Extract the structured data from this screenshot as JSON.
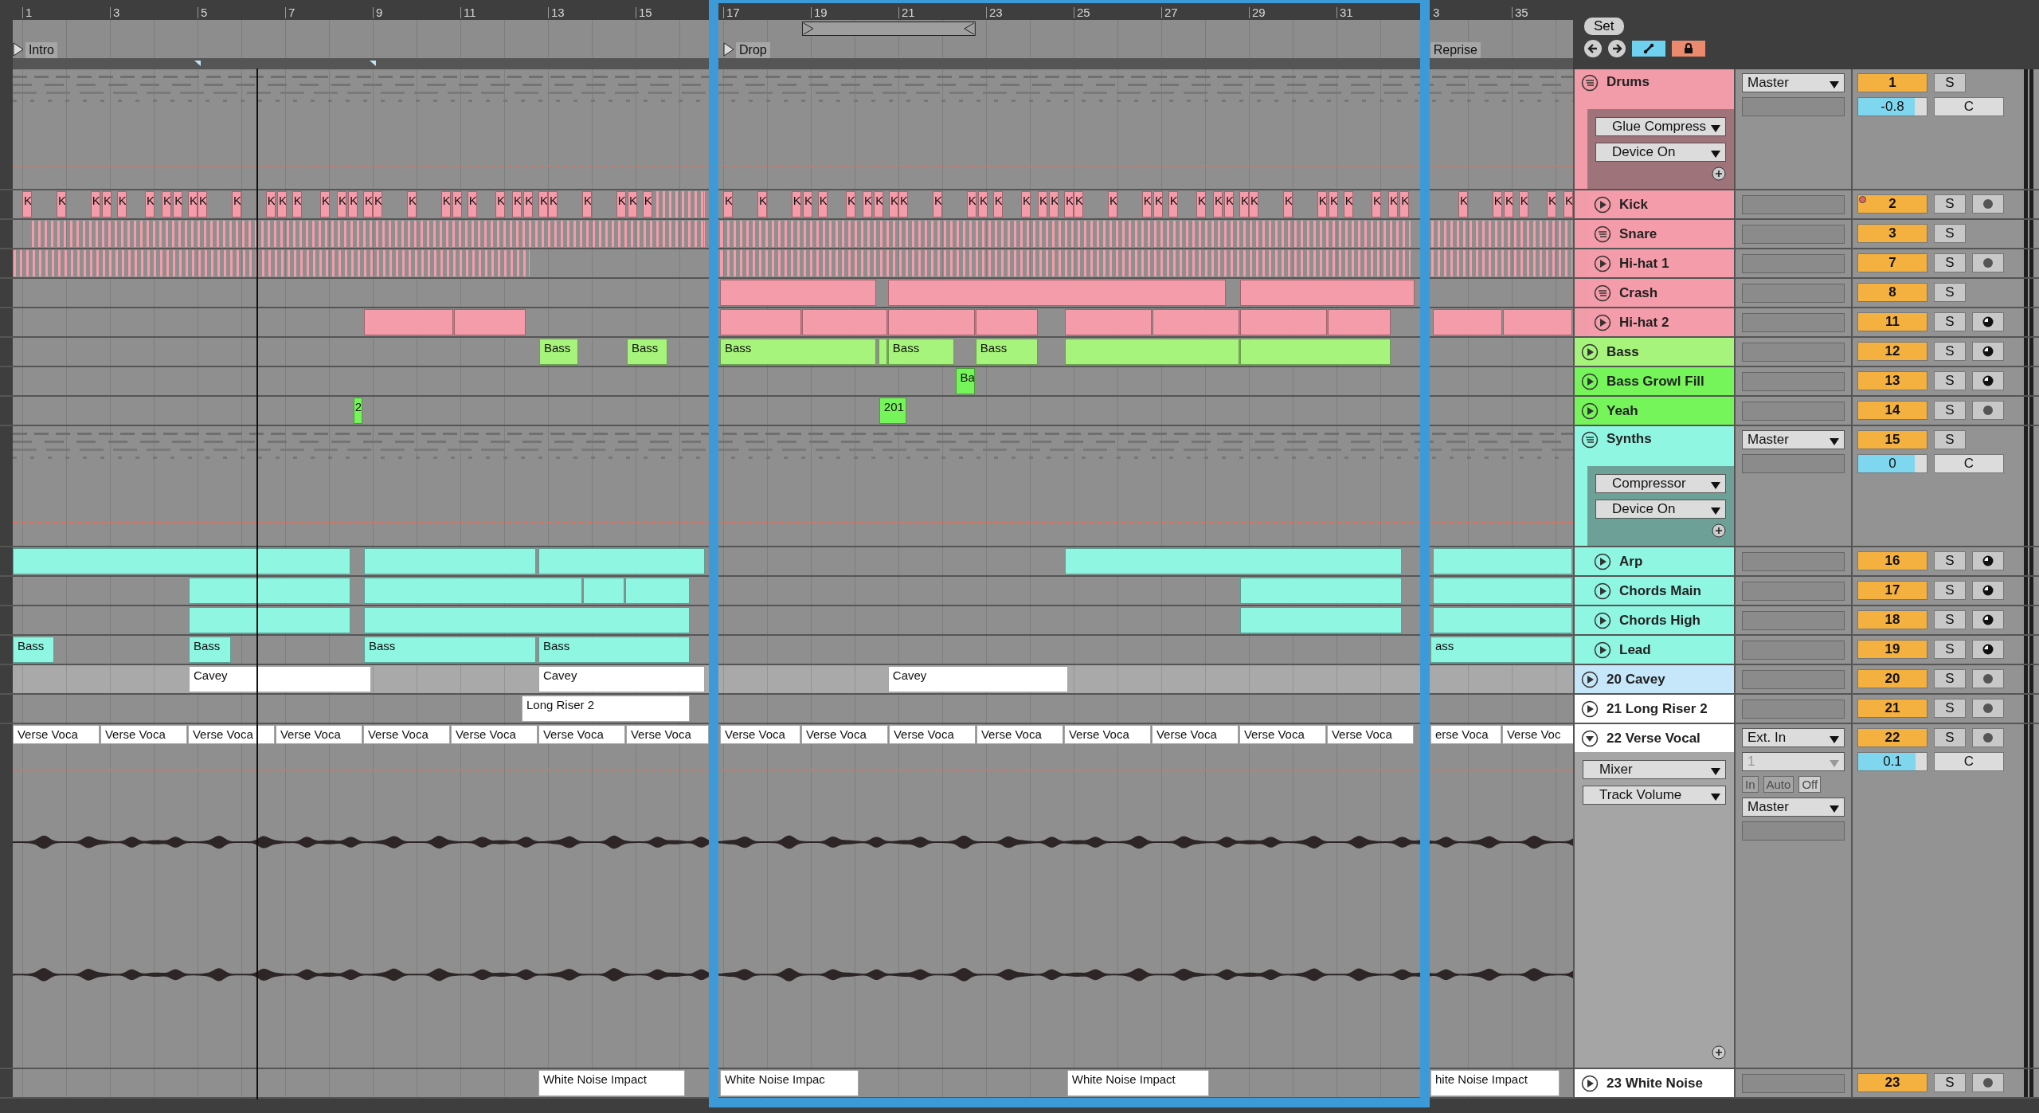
{
  "ruler": [
    "1",
    "3",
    "5",
    "7",
    "9",
    "11",
    "13",
    "15",
    "17",
    "19",
    "21",
    "23",
    "25",
    "27",
    "29",
    "31",
    "3",
    "35"
  ],
  "locators": [
    {
      "label": "Intro"
    },
    {
      "label": "Drop"
    },
    {
      "label": "Reprise"
    }
  ],
  "set_panel": {
    "label": "Set",
    "toggles": [
      {
        "on": true
      },
      {
        "on": true
      }
    ]
  },
  "tracks": [
    {
      "name": "Drums",
      "kind": "group",
      "expanded": true,
      "selected": false,
      "alert": false,
      "automation": true,
      "color": "#f29ca9",
      "devices": {
        "device": "Glue Compress",
        "parameter": "Device On"
      },
      "io": {
        "output": "Master"
      },
      "number": "1",
      "solo": "S",
      "volume": {
        "value": "-0.8",
        "level": 0.82
      },
      "pan": "C",
      "children": [
        {
          "name": "Kick",
          "kind": "track",
          "expanded": false,
          "selected": false,
          "alert": true,
          "automation": false,
          "color": "#f49ca9",
          "number": "2",
          "solo": "S",
          "arm": {
            "kind": "dot"
          },
          "clips": [
            {
              "kind": "block",
              "label": "K"
            },
            {
              "kind": "block",
              "label": "K"
            },
            {
              "kind": "block",
              "label": "K"
            },
            {
              "kind": "block",
              "label": "K"
            },
            {
              "kind": "block",
              "label": "K"
            },
            {
              "kind": "block",
              "label": "K"
            },
            {
              "kind": "block",
              "label": "K"
            },
            {
              "kind": "block",
              "label": "K"
            },
            {
              "kind": "block",
              "label": "K"
            },
            {
              "kind": "block",
              "label": "K"
            },
            {
              "kind": "block",
              "label": "K"
            },
            {
              "kind": "block",
              "label": "K"
            },
            {
              "kind": "block",
              "label": "K"
            },
            {
              "kind": "block",
              "label": "K"
            },
            {
              "kind": "block",
              "label": "K"
            },
            {
              "kind": "block",
              "label": "K"
            },
            {
              "kind": "block",
              "label": "K"
            },
            {
              "kind": "block",
              "label": "K"
            },
            {
              "kind": "block",
              "label": "K"
            },
            {
              "kind": "block",
              "label": "K"
            },
            {
              "kind": "block",
              "label": "K"
            },
            {
              "kind": "block",
              "label": "K"
            },
            {
              "kind": "block",
              "label": "K"
            },
            {
              "kind": "block",
              "label": "K"
            },
            {
              "kind": "block",
              "label": "K"
            },
            {
              "kind": "block",
              "label": "K"
            },
            {
              "kind": "block",
              "label": "K"
            },
            {
              "kind": "block",
              "label": "K"
            },
            {
              "kind": "block",
              "label": "K"
            },
            {
              "kind": "block",
              "label": "K"
            },
            {
              "kind": "block",
              "label": "K"
            },
            {
              "kind": "block",
              "label": "K"
            },
            {
              "kind": "pattern"
            },
            {
              "kind": "block",
              "label": "K"
            },
            {
              "kind": "block",
              "label": "K"
            },
            {
              "kind": "block",
              "label": "K"
            },
            {
              "kind": "block",
              "label": "K"
            },
            {
              "kind": "block",
              "label": "K"
            },
            {
              "kind": "block",
              "label": "K"
            },
            {
              "kind": "block",
              "label": "K"
            },
            {
              "kind": "block",
              "label": "K"
            },
            {
              "kind": "block",
              "label": "K"
            },
            {
              "kind": "block",
              "label": "K"
            },
            {
              "kind": "block",
              "label": "K"
            },
            {
              "kind": "block",
              "label": "K"
            },
            {
              "kind": "block",
              "label": "K"
            },
            {
              "kind": "block",
              "label": "K"
            },
            {
              "kind": "block",
              "label": "K"
            },
            {
              "kind": "block",
              "label": "K"
            },
            {
              "kind": "block",
              "label": "K"
            },
            {
              "kind": "block",
              "label": "K"
            },
            {
              "kind": "block",
              "label": "K"
            },
            {
              "kind": "block",
              "label": "K"
            },
            {
              "kind": "block",
              "label": "K"
            },
            {
              "kind": "block",
              "label": "K"
            },
            {
              "kind": "block",
              "label": "K"
            },
            {
              "kind": "block",
              "label": "K"
            },
            {
              "kind": "block",
              "label": "K"
            },
            {
              "kind": "block",
              "label": "K"
            },
            {
              "kind": "block",
              "label": "K"
            },
            {
              "kind": "block",
              "label": "K"
            },
            {
              "kind": "block",
              "label": "K"
            },
            {
              "kind": "block",
              "label": "K"
            },
            {
              "kind": "block",
              "label": "K"
            },
            {
              "kind": "block",
              "label": "K"
            },
            {
              "kind": "block",
              "label": "K"
            },
            {
              "kind": "block",
              "label": "K"
            },
            {
              "kind": "block",
              "label": "K"
            },
            {
              "kind": "block",
              "label": "K"
            },
            {
              "kind": "block",
              "label": "K"
            },
            {
              "kind": "block",
              "label": "K"
            },
            {
              "kind": "block",
              "label": "K"
            },
            {
              "kind": "block",
              "label": "K"
            },
            {
              "kind": "block",
              "label": "K"
            }
          ]
        },
        {
          "name": "Snare",
          "kind": "rack",
          "expanded": false,
          "selected": false,
          "alert": false,
          "automation": false,
          "color": "#f49ca9",
          "number": "3",
          "solo": "S",
          "clips": [
            {
              "kind": "pattern"
            },
            {
              "kind": "pattern"
            },
            {
              "kind": "pattern"
            }
          ]
        },
        {
          "name": "Hi-hat 1",
          "kind": "track",
          "expanded": false,
          "selected": false,
          "alert": false,
          "automation": false,
          "color": "#f49ca9",
          "number": "7",
          "solo": "S",
          "arm": {
            "kind": "dot"
          },
          "clips": [
            {
              "kind": "pattern"
            },
            {
              "kind": "pattern"
            },
            {
              "kind": "pattern"
            }
          ]
        },
        {
          "name": "Crash",
          "kind": "rack",
          "expanded": false,
          "selected": false,
          "alert": false,
          "automation": false,
          "color": "#f49ca9",
          "number": "8",
          "solo": "S",
          "clips": [
            {
              "kind": "block"
            },
            {
              "kind": "block"
            },
            {
              "kind": "block"
            }
          ]
        },
        {
          "name": "Hi-hat 2",
          "kind": "track",
          "expanded": false,
          "selected": false,
          "alert": false,
          "automation": false,
          "color": "#f49ca9",
          "number": "11",
          "solo": "S",
          "arm": {
            "kind": "half"
          },
          "clips": [
            {
              "kind": "block"
            },
            {
              "kind": "block"
            },
            {
              "kind": "block"
            },
            {
              "kind": "block"
            },
            {
              "kind": "block"
            },
            {
              "kind": "block"
            },
            {
              "kind": "block"
            },
            {
              "kind": "block"
            },
            {
              "kind": "block"
            },
            {
              "kind": "block"
            },
            {
              "kind": "block"
            },
            {
              "kind": "block"
            }
          ]
        }
      ]
    },
    {
      "name": "Bass",
      "kind": "track",
      "expanded": false,
      "selected": false,
      "alert": false,
      "automation": false,
      "color": "#a7f47c",
      "number": "12",
      "solo": "S",
      "arm": {
        "kind": "half"
      },
      "clips": [
        {
          "kind": "block",
          "label": "Bass"
        },
        {
          "kind": "block",
          "label": "Bass"
        },
        {
          "kind": "block",
          "label": "Bass"
        },
        {
          "kind": "block"
        },
        {
          "kind": "block",
          "label": "Bass"
        },
        {
          "kind": "block",
          "label": "Bass"
        },
        {
          "kind": "block"
        },
        {
          "kind": "block"
        }
      ]
    },
    {
      "name": "Bass Growl Fill",
      "kind": "track",
      "expanded": false,
      "selected": false,
      "alert": false,
      "automation": false,
      "color": "#76f55b",
      "number": "13",
      "solo": "S",
      "arm": {
        "kind": "half"
      },
      "clips": [
        {
          "kind": "block",
          "label": "Ba"
        }
      ]
    },
    {
      "name": "Yeah",
      "kind": "track",
      "expanded": false,
      "selected": false,
      "alert": false,
      "automation": false,
      "color": "#76f55b",
      "number": "14",
      "solo": "S",
      "arm": {
        "kind": "dot"
      },
      "clips": [
        {
          "kind": "block",
          "label": "2"
        },
        {
          "kind": "block",
          "label": "201"
        }
      ]
    },
    {
      "name": "Synths",
      "kind": "group",
      "expanded": true,
      "selected": false,
      "alert": false,
      "automation": true,
      "color": "#8ff6e2",
      "devices": {
        "device": "Compressor",
        "parameter": "Device On"
      },
      "io": {
        "output": "Master"
      },
      "number": "15",
      "solo": "S",
      "volume": {
        "value": "0",
        "level": 0.82
      },
      "pan": "C",
      "children": [
        {
          "name": "Arp",
          "kind": "track",
          "expanded": false,
          "selected": false,
          "alert": false,
          "automation": false,
          "color": "#8ff6e2",
          "number": "16",
          "solo": "S",
          "arm": {
            "kind": "half"
          },
          "clips": [
            {
              "kind": "block"
            },
            {
              "kind": "block"
            },
            {
              "kind": "block"
            },
            {
              "kind": "block"
            },
            {
              "kind": "block"
            }
          ]
        },
        {
          "name": "Chords Main",
          "kind": "track",
          "expanded": false,
          "selected": false,
          "alert": false,
          "automation": false,
          "color": "#8ff6e2",
          "number": "17",
          "solo": "S",
          "arm": {
            "kind": "half"
          },
          "clips": [
            {
              "kind": "block"
            },
            {
              "kind": "block"
            },
            {
              "kind": "block"
            },
            {
              "kind": "block"
            },
            {
              "kind": "block"
            },
            {
              "kind": "block"
            }
          ]
        },
        {
          "name": "Chords High",
          "kind": "track",
          "expanded": false,
          "selected": false,
          "alert": false,
          "automation": false,
          "color": "#8ff6e2",
          "number": "18",
          "solo": "S",
          "arm": {
            "kind": "half"
          },
          "clips": [
            {
              "kind": "block"
            },
            {
              "kind": "block"
            },
            {
              "kind": "block"
            },
            {
              "kind": "block"
            }
          ]
        },
        {
          "name": "Lead",
          "kind": "track",
          "expanded": false,
          "selected": false,
          "alert": false,
          "automation": false,
          "color": "#8ff6e2",
          "number": "19",
          "solo": "S",
          "arm": {
            "kind": "half"
          },
          "clips": [
            {
              "kind": "block",
              "label": "Bass"
            },
            {
              "kind": "block",
              "label": "Bass"
            },
            {
              "kind": "block",
              "label": "Bass"
            },
            {
              "kind": "block",
              "label": "Bass"
            },
            {
              "kind": "block",
              "label": "ass"
            }
          ]
        }
      ]
    },
    {
      "name": "20 Cavey",
      "kind": "track",
      "expanded": false,
      "selected": true,
      "alert": false,
      "automation": false,
      "color": "#ffffff",
      "number": "20",
      "solo": "S",
      "arm": {
        "kind": "dot"
      },
      "clips": [
        {
          "kind": "block",
          "label": "Cavey"
        },
        {
          "kind": "block",
          "label": "Cavey"
        },
        {
          "kind": "block",
          "label": "Cavey"
        }
      ]
    },
    {
      "name": "21 Long Riser 2",
      "kind": "track",
      "expanded": false,
      "selected": false,
      "alert": false,
      "automation": false,
      "color": "#ffffff",
      "number": "21",
      "solo": "S",
      "arm": {
        "kind": "dot"
      },
      "clips": [
        {
          "kind": "block",
          "label": "Long Riser 2"
        }
      ]
    },
    {
      "name": "22 Verse Vocal",
      "kind": "track",
      "expanded": true,
      "selected": false,
      "alert": false,
      "automation": true,
      "color": "#ffffff",
      "devices": {
        "device": "Mixer",
        "parameter": "Track Volume"
      },
      "io": {
        "input": "Ext. In",
        "input_channel": "1",
        "disabled": true,
        "monitor": [
          {
            "label": "In",
            "selected": false
          },
          {
            "label": "Auto",
            "selected": false
          },
          {
            "label": "Off",
            "selected": true
          }
        ],
        "output": "Master"
      },
      "number": "22",
      "solo": "S",
      "arm": {
        "kind": "dot"
      },
      "volume": {
        "value": "0.1",
        "level": 0.84
      },
      "pan": "C",
      "clips": [
        {
          "kind": "block",
          "label": "Verse Voca"
        },
        {
          "kind": "block",
          "label": "Verse Voca"
        },
        {
          "kind": "block",
          "label": "Verse Voca"
        },
        {
          "kind": "block",
          "label": "Verse Voca"
        },
        {
          "kind": "block",
          "label": "Verse Voca"
        },
        {
          "kind": "block",
          "label": "Verse Voca"
        },
        {
          "kind": "block",
          "label": "Verse Voca"
        },
        {
          "kind": "block",
          "label": "Verse Voca"
        },
        {
          "kind": "block",
          "label": "Verse Voca"
        },
        {
          "kind": "block",
          "label": "Verse Voca"
        },
        {
          "kind": "block",
          "label": "Verse Voca"
        },
        {
          "kind": "block",
          "label": "Verse Voca"
        },
        {
          "kind": "block",
          "label": "Verse Voca"
        },
        {
          "kind": "block",
          "label": "Verse Voca"
        },
        {
          "kind": "block",
          "label": "Verse Voca"
        },
        {
          "kind": "block",
          "label": "Verse Voca"
        },
        {
          "kind": "block",
          "label": "erse Voca"
        },
        {
          "kind": "block",
          "label": "Verse Voc"
        }
      ]
    },
    {
      "name": "23 White Noise",
      "kind": "track",
      "expanded": false,
      "selected": false,
      "alert": false,
      "automation": false,
      "color": "#ffffff",
      "number": "23",
      "solo": "S",
      "arm": {
        "kind": "dot"
      },
      "clips": [
        {
          "kind": "block",
          "label": "White Noise Impact"
        },
        {
          "kind": "block",
          "label": "White Noise Impac"
        },
        {
          "kind": "block",
          "label": "White Noise Impact"
        },
        {
          "kind": "block",
          "label": "hite Noise Impact"
        }
      ]
    }
  ]
}
